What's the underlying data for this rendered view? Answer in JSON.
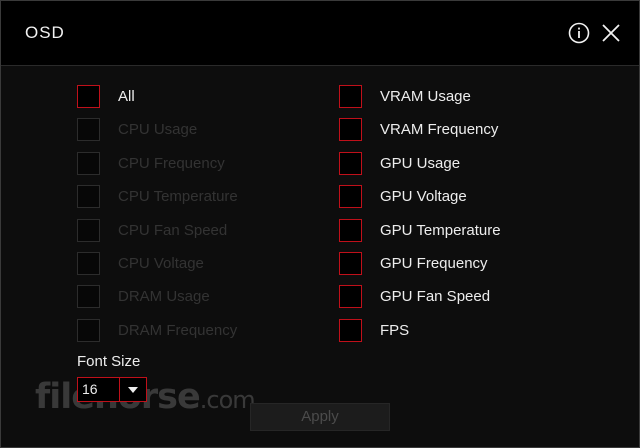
{
  "window": {
    "title": "OSD"
  },
  "options": {
    "left": [
      {
        "label": "All",
        "enabled": true
      },
      {
        "label": "CPU Usage",
        "enabled": false
      },
      {
        "label": "CPU Frequency",
        "enabled": false
      },
      {
        "label": "CPU Temperature",
        "enabled": false
      },
      {
        "label": "CPU Fan Speed",
        "enabled": false
      },
      {
        "label": "CPU Voltage",
        "enabled": false
      },
      {
        "label": "DRAM Usage",
        "enabled": false
      },
      {
        "label": "DRAM Frequency",
        "enabled": false
      }
    ],
    "right": [
      {
        "label": "VRAM Usage",
        "enabled": true
      },
      {
        "label": "VRAM Frequency",
        "enabled": true
      },
      {
        "label": "GPU Usage",
        "enabled": true
      },
      {
        "label": "GPU Voltage",
        "enabled": true
      },
      {
        "label": "GPU Temperature",
        "enabled": true
      },
      {
        "label": "GPU Frequency",
        "enabled": true
      },
      {
        "label": "GPU Fan Speed",
        "enabled": true
      },
      {
        "label": "FPS",
        "enabled": true
      }
    ]
  },
  "font_size": {
    "label": "Font Size",
    "value": "16"
  },
  "apply_label": "Apply",
  "watermark": {
    "main": "filehorse",
    "suffix": ".com"
  },
  "icons": {
    "info": "info-icon",
    "close": "close-icon",
    "dropdown": "caret-down-icon"
  },
  "colors": {
    "accent": "#c0101a",
    "text": "#ededed",
    "disabled_text": "#333333",
    "background": "#0d0d0d"
  }
}
